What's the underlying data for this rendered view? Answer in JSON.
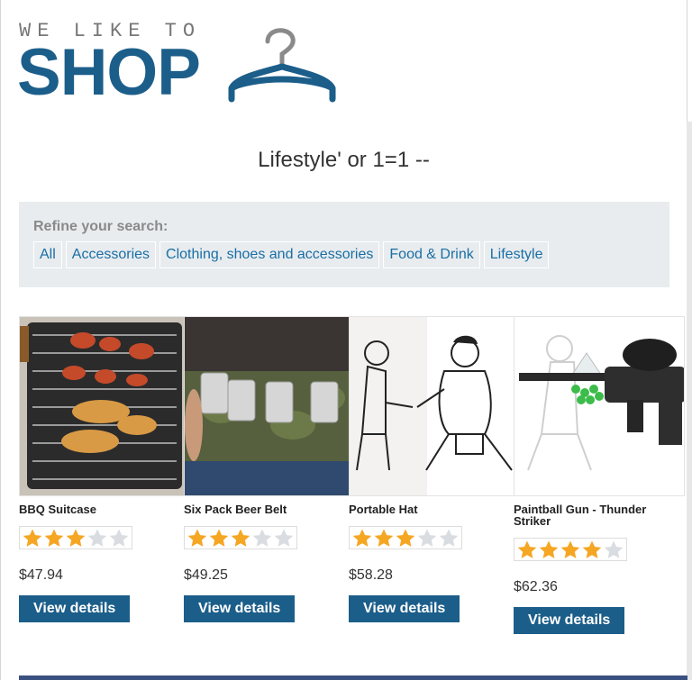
{
  "logo": {
    "tagline": "WE LIKE TO",
    "wordmark": "SHOP",
    "icon": "hanger-icon",
    "color": "#1c5e8a"
  },
  "search": {
    "title": "Lifestyle' or 1=1 --"
  },
  "refine": {
    "label": "Refine your search:",
    "filters": [
      "All",
      "Accessories",
      "Clothing, shoes and accessories",
      "Food & Drink",
      "Lifestyle"
    ]
  },
  "products": [
    {
      "name": "BBQ Suitcase",
      "rating": 3,
      "max_rating": 5,
      "price": "$47.94",
      "button": "View details"
    },
    {
      "name": "Six Pack Beer Belt",
      "rating": 3,
      "max_rating": 5,
      "price": "$49.25",
      "button": "View details"
    },
    {
      "name": "Portable Hat",
      "rating": 3,
      "max_rating": 5,
      "price": "$58.28",
      "button": "View details"
    },
    {
      "name": "Paintball Gun - Thunder Striker",
      "rating": 4,
      "max_rating": 5,
      "price": "$62.36",
      "button": "View details"
    }
  ],
  "colors": {
    "accent": "#1c5e8a",
    "star_on": "#f5a623",
    "star_off": "#d9dde1",
    "refine_bg": "#e8ecef"
  }
}
